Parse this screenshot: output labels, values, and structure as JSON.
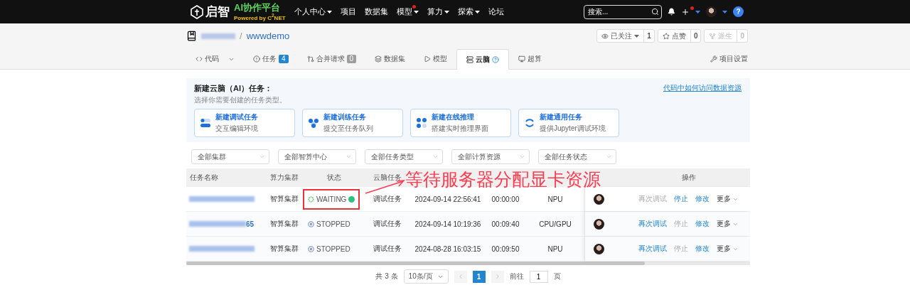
{
  "nav": {
    "logo": "启智",
    "brand": "AI协作平台",
    "powered": "Powered by C$^{2}$NET",
    "menu": [
      {
        "label": "个人中心",
        "dropdown": true,
        "dot": false
      },
      {
        "label": "项目",
        "dropdown": false,
        "dot": false
      },
      {
        "label": "数据集",
        "dropdown": false,
        "dot": false
      },
      {
        "label": "模型",
        "dropdown": true,
        "dot": true
      },
      {
        "label": "算力",
        "dropdown": true,
        "dot": false
      },
      {
        "label": "探索",
        "dropdown": true,
        "dot": false
      },
      {
        "label": "论坛",
        "dropdown": false,
        "dot": false
      }
    ],
    "search": {
      "placeholder": "搜索..."
    },
    "help": "?"
  },
  "repo": {
    "separator": "/",
    "name": "wwwdemo",
    "actions": [
      {
        "kind": "watch",
        "label": "已关注",
        "count": "1",
        "disabled": false
      },
      {
        "kind": "star",
        "label": "点赞",
        "count": "0",
        "disabled": false
      },
      {
        "kind": "fork",
        "label": "派生",
        "count": "0",
        "disabled": true
      }
    ]
  },
  "tabs": [
    {
      "kind": "code",
      "label": "代码",
      "selected": false
    },
    {
      "kind": "issue",
      "label": "任务",
      "badge": {
        "text": "4",
        "color": "#2185d0"
      },
      "selected": false
    },
    {
      "kind": "pull",
      "label": "合并请求",
      "badge": {
        "text": "0",
        "color": "#9e9e9e"
      },
      "selected": false
    },
    {
      "kind": "dataset",
      "label": "数据集",
      "selected": false
    },
    {
      "kind": "model",
      "label": "模型",
      "selected": false
    },
    {
      "kind": "cloud",
      "label": "云脑",
      "selected": true
    },
    {
      "kind": "hpc",
      "label": "超算",
      "selected": false
    }
  ],
  "settings": "项目设置",
  "new_task": {
    "title": "新建云脑（AI）任务：",
    "subtitle": "选择你需要创建的任务类型。",
    "link": "代码中如何访问数据资源",
    "cards": [
      {
        "kind": "debug",
        "title": "新建调试任务",
        "desc": "交互编辑环境"
      },
      {
        "kind": "train",
        "title": "新建训练任务",
        "desc": "提交至任务队列"
      },
      {
        "kind": "infer",
        "title": "新建在线推理",
        "desc": "搭建实时推理界面"
      },
      {
        "kind": "general",
        "title": "新建通用任务",
        "desc": "提供Jupyter调试环境"
      }
    ]
  },
  "filters": [
    {
      "placeholder": "全部集群"
    },
    {
      "placeholder": "全部智算中心"
    },
    {
      "placeholder": "全部任务类型"
    },
    {
      "placeholder": "全部计算资源"
    },
    {
      "placeholder": "全部任务状态"
    }
  ],
  "table": {
    "columns": [
      "任务名称",
      "算力集群",
      "状态",
      "云脑任务",
      null,
      null,
      null,
      null,
      "操作"
    ],
    "rows": [
      {
        "name_tail": null,
        "highlighted": true,
        "cluster": "智算集群",
        "status": {
          "kind": "waiting",
          "label": "WAITING"
        },
        "type": "调试任务",
        "created": "2024-09-14 22:56:41",
        "duration": "00:00:00",
        "resource": "NPU",
        "actions": [
          {
            "label": "再次调试",
            "disabled": true
          },
          {
            "label": "停止",
            "disabled": false
          },
          {
            "label": "修改",
            "disabled": false
          }
        ],
        "more": "更多"
      },
      {
        "name_tail": "65",
        "highlighted": false,
        "cluster": "智算集群",
        "status": {
          "kind": "stopped",
          "label": "STOPPED"
        },
        "type": "调试任务",
        "created": "2024-09-14 10:19:36",
        "duration": "00:09:40",
        "resource": "CPU/GPU",
        "actions": [
          {
            "label": "再次调试",
            "disabled": false
          },
          {
            "label": "停止",
            "disabled": true
          },
          {
            "label": "修改",
            "disabled": false
          }
        ],
        "more": "更多"
      },
      {
        "name_tail": null,
        "highlighted": false,
        "cluster": "智算集群",
        "status": {
          "kind": "stopped",
          "label": "STOPPED"
        },
        "type": "调试任务",
        "created": "2024-08-28 16:03:15",
        "duration": "00:09:50",
        "resource": "NPU",
        "actions": [
          {
            "label": "再次调试",
            "disabled": false
          },
          {
            "label": "停止",
            "disabled": true
          },
          {
            "label": "修改",
            "disabled": false
          }
        ],
        "more": "更多"
      }
    ]
  },
  "pagination": {
    "total": "共 3 条",
    "page_size": "10条/页",
    "pages": [
      {
        "label": "1",
        "selected": true
      }
    ],
    "goto": "前往",
    "goto_value": "1",
    "unit": "页"
  },
  "annotation": {
    "text": "等待服务器分配显卡资源"
  }
}
